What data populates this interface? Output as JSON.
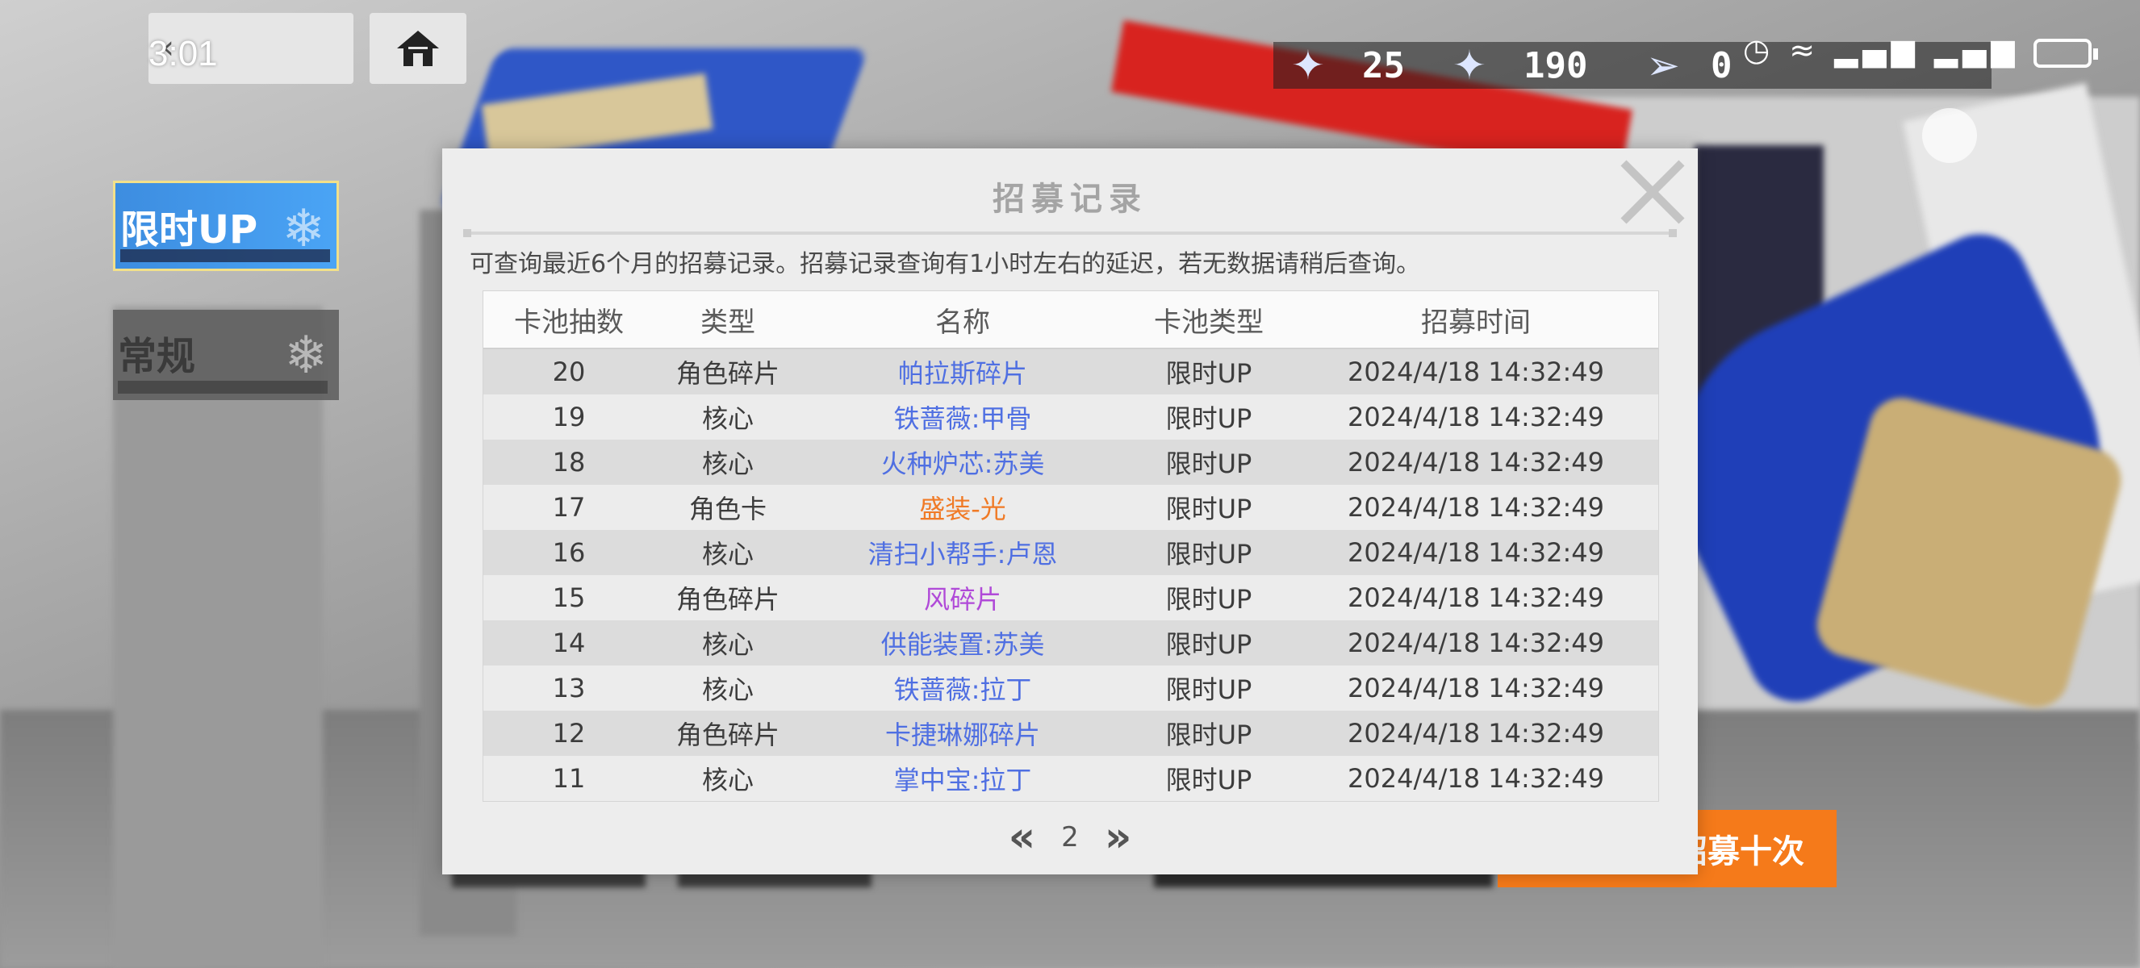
{
  "status_bar": {
    "time": "3:01"
  },
  "tabs": [
    {
      "label": "限时UP",
      "active": true
    },
    {
      "label": "常规",
      "active": false
    }
  ],
  "resources": [
    {
      "icon": "crystal-icon",
      "value": "25"
    },
    {
      "icon": "shard-icon",
      "value": "190"
    },
    {
      "icon": "gun-icon",
      "value": "0"
    }
  ],
  "recruit_ten_label": "招募十次",
  "modal": {
    "title": "招募记录",
    "notice": "可查询最近6个月的招募记录。招募记录查询有1小时左右的延迟，若无数据请稍后查询。",
    "columns": [
      "卡池抽数",
      "类型",
      "名称",
      "卡池类型",
      "招募时间"
    ],
    "rows": [
      {
        "pull": "20",
        "type": "角色碎片",
        "name": "帕拉斯碎片",
        "name_color": "#4f6fe2",
        "pool": "限时UP",
        "time": "2024/4/18 14:32:49"
      },
      {
        "pull": "19",
        "type": "核心",
        "name": "铁蔷薇:甲骨",
        "name_color": "#4f6fe2",
        "pool": "限时UP",
        "time": "2024/4/18 14:32:49"
      },
      {
        "pull": "18",
        "type": "核心",
        "name": "火种炉芯:苏美",
        "name_color": "#4f6fe2",
        "pool": "限时UP",
        "time": "2024/4/18 14:32:49"
      },
      {
        "pull": "17",
        "type": "角色卡",
        "name": "盛装-光",
        "name_color": "#f07a26",
        "pool": "限时UP",
        "time": "2024/4/18 14:32:49"
      },
      {
        "pull": "16",
        "type": "核心",
        "name": "清扫小帮手:卢恩",
        "name_color": "#4f6fe2",
        "pool": "限时UP",
        "time": "2024/4/18 14:32:49"
      },
      {
        "pull": "15",
        "type": "角色碎片",
        "name": "风碎片",
        "name_color": "#b04ad8",
        "pool": "限时UP",
        "time": "2024/4/18 14:32:49"
      },
      {
        "pull": "14",
        "type": "核心",
        "name": "供能装置:苏美",
        "name_color": "#4f6fe2",
        "pool": "限时UP",
        "time": "2024/4/18 14:32:49"
      },
      {
        "pull": "13",
        "type": "核心",
        "name": "铁蔷薇:拉丁",
        "name_color": "#4f6fe2",
        "pool": "限时UP",
        "time": "2024/4/18 14:32:49"
      },
      {
        "pull": "12",
        "type": "角色碎片",
        "name": "卡捷琳娜碎片",
        "name_color": "#4f6fe2",
        "pool": "限时UP",
        "time": "2024/4/18 14:32:49"
      },
      {
        "pull": "11",
        "type": "核心",
        "name": "掌中宝:拉丁",
        "name_color": "#4f6fe2",
        "pool": "限时UP",
        "time": "2024/4/18 14:32:49"
      }
    ],
    "pagination": {
      "prev": "«",
      "page": "2",
      "next": "»"
    }
  }
}
